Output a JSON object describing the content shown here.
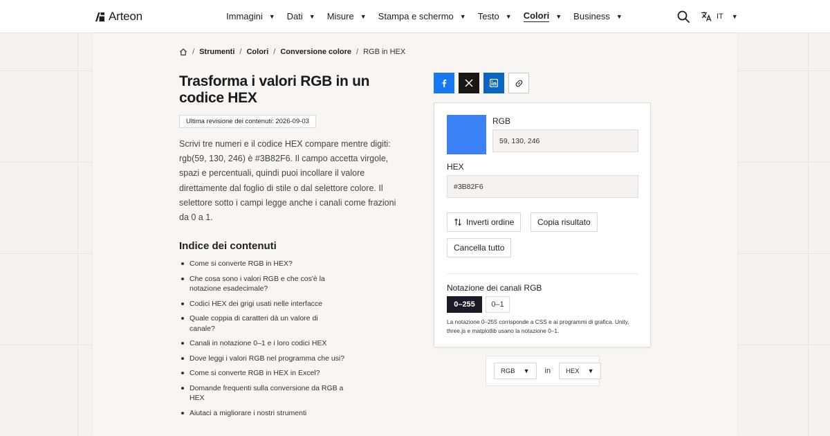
{
  "brand": {
    "name": "Arteon"
  },
  "nav": {
    "items": [
      {
        "label": "Immagini",
        "active": false
      },
      {
        "label": "Dati",
        "active": false
      },
      {
        "label": "Misure",
        "active": false
      },
      {
        "label": "Stampa e schermo",
        "active": false
      },
      {
        "label": "Testo",
        "active": false
      },
      {
        "label": "Colori",
        "active": true
      },
      {
        "label": "Business",
        "active": false
      }
    ],
    "language": "IT",
    "icons": {
      "search": "search-icon",
      "language": "translate-icon"
    }
  },
  "breadcrumb": {
    "items": [
      "Strumenti",
      "Colori",
      "Conversione colore"
    ],
    "current": "RGB in HEX",
    "separator": "/"
  },
  "page": {
    "title": "Trasforma i valori RGB in un codice HEX",
    "revision": "Ultima revisione dei contenuti: 2026-09-03",
    "intro": "Scrivi tre numeri e il codice HEX compare mentre digiti: rgb(59, 130, 246) è #3B82F6. Il campo accetta virgole, spazi e percentuali, quindi puoi incollare il valore direttamente dal foglio di stile o dal selettore colore. Il selettore sotto i campi legge anche i canali come frazioni da 0 a 1."
  },
  "toc": {
    "title": "Indice dei contenuti",
    "items": [
      "Come si converte RGB in HEX?",
      "Che cosa sono i valori RGB e che cos'è la notazione esadecimale?",
      "Codici HEX dei grigi usati nelle interfacce",
      "Quale coppia di caratteri dà un valore di canale?",
      "Canali in notazione 0–1 e i loro codici HEX",
      "Dove leggi i valori RGB nel programma che usi?",
      "Come si converte RGB in HEX in Excel?",
      "Domande frequenti sulla conversione da RGB a HEX",
      "Aiutaci a migliorare i nostri strumenti"
    ]
  },
  "share": {
    "icons": [
      "facebook-icon",
      "x-icon",
      "linkedin-icon",
      "link-icon"
    ],
    "colors": {
      "facebook": "#1877f2",
      "x": "#1a1613",
      "linkedin": "#0a66c2"
    }
  },
  "converter": {
    "swatch_color": "#3B82F6",
    "rgb_label": "RGB",
    "rgb_value": "59, 130, 246",
    "hex_label": "HEX",
    "hex_value": "#3B82F6",
    "invert_label": "Inverti ordine",
    "copy_label": "Copia risultato",
    "clear_label": "Cancella tutto",
    "notation_title": "Notazione dei canali RGB",
    "notation_options": [
      "0–255",
      "0–1"
    ],
    "notation_selected": "0–255",
    "notation_note": "La notazione 0–255 corrisponde a CSS e ai programmi di grafica. Unity, three.js e matplotlib usano la notazione 0–1."
  },
  "fromto": {
    "from": "RGB",
    "connector": "in",
    "to": "HEX"
  }
}
